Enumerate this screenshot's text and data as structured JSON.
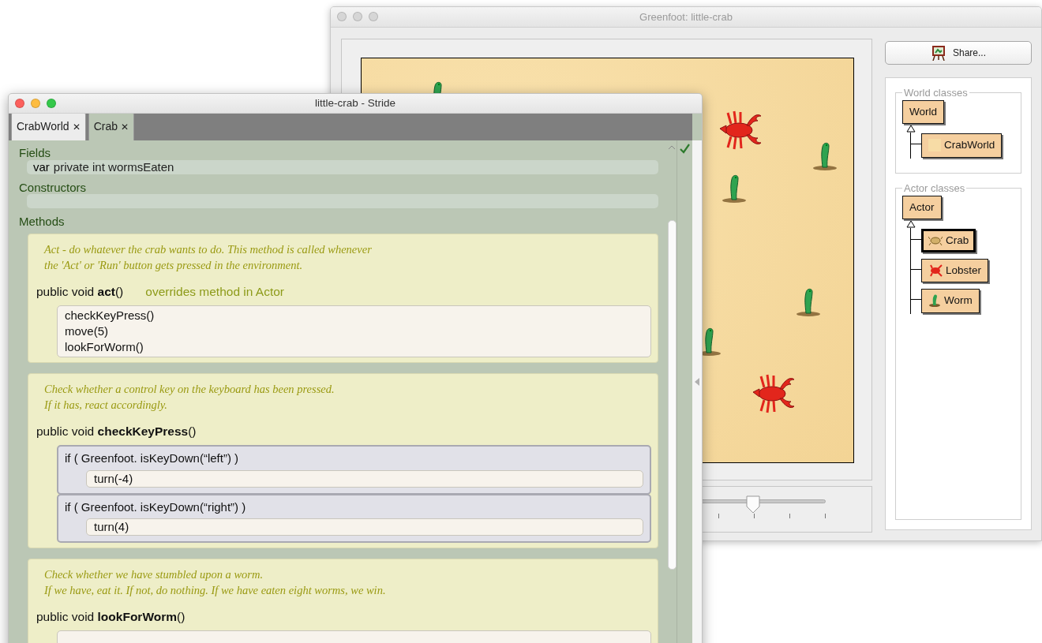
{
  "greenfoot_window": {
    "title": "Greenfoot: little-crab",
    "world": {
      "actors": [
        {
          "kind": "worm"
        },
        {
          "kind": "lobster"
        },
        {
          "kind": "worm"
        },
        {
          "kind": "worm"
        },
        {
          "kind": "worm"
        },
        {
          "kind": "worm"
        },
        {
          "kind": "lobster"
        }
      ]
    },
    "speed_slider": {
      "level": 0.71
    },
    "share_button": "Share...",
    "class_groups": [
      {
        "title": "World classes",
        "classes": [
          {
            "name": "World",
            "selected": false,
            "children": [
              {
                "name": "CrabWorld",
                "selected": false
              }
            ]
          }
        ]
      },
      {
        "title": "Actor classes",
        "classes": [
          {
            "name": "Actor",
            "selected": false,
            "children": [
              {
                "name": "Crab",
                "selected": true
              },
              {
                "name": "Lobster",
                "selected": false
              },
              {
                "name": "Worm",
                "selected": false
              }
            ]
          }
        ]
      }
    ]
  },
  "stride_window": {
    "title": "little-crab - Stride",
    "tabs": [
      {
        "label": "CrabWorld",
        "close": "✕",
        "selected": false
      },
      {
        "label": "Crab",
        "close": "✕",
        "selected": true
      }
    ],
    "sections": [
      {
        "kind": "fields",
        "title": "Fields",
        "items": [
          {
            "keyword": "var",
            "text": "private int wormsEaten"
          }
        ]
      },
      {
        "kind": "constructors",
        "title": "Constructors"
      },
      {
        "kind": "methods",
        "title": "Methods",
        "methods": [
          {
            "comment": [
              "Act - do whatever the crab wants to do. This method is called whenever",
              "the 'Act' or 'Run' button gets pressed in the environment."
            ],
            "signature": "public void **act**()",
            "note": "overrides method in Actor",
            "body": [
              {
                "kind": "call",
                "text": "checkKeyPress()"
              },
              {
                "kind": "call",
                "text": "move(5)"
              },
              {
                "kind": "call",
                "text": "lookForWorm()"
              }
            ]
          },
          {
            "comment": [
              "Check whether a control key on the keyboard has been pressed.",
              "If it has, react accordingly."
            ],
            "signature": "public void **checkKeyPress**()",
            "body": [
              {
                "kind": "if",
                "text": "if ( Greenfoot. isKeyDown(“left”) )",
                "body": [
                  {
                    "kind": "call",
                    "text": "turn(-4)"
                  }
                ]
              },
              {
                "kind": "if",
                "text": "if ( Greenfoot. isKeyDown(“right”) )",
                "body": [
                  {
                    "kind": "call",
                    "text": "turn(4)"
                  }
                ]
              }
            ]
          },
          {
            "comment": [
              "Check whether we have stumbled upon a worm.",
              "If we have, eat it. If not, do nothing. If we have eaten eight worms, we win."
            ],
            "signature": "public void **lookForWorm**()"
          }
        ]
      }
    ]
  }
}
